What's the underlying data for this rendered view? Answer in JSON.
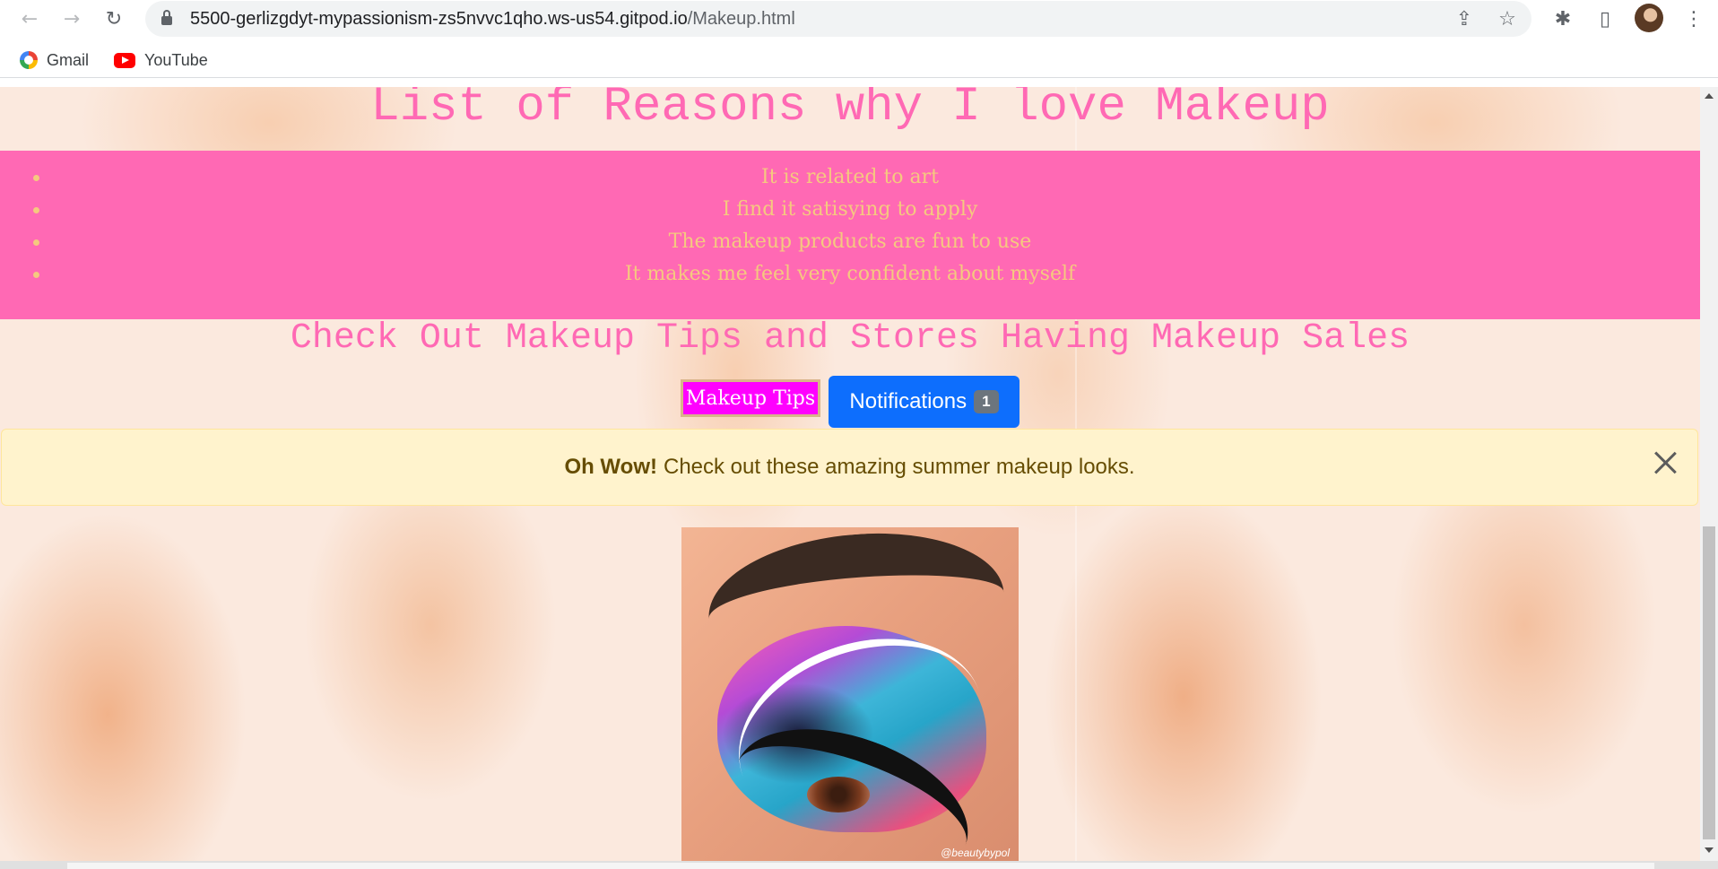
{
  "browser": {
    "url_host": "5500-gerlizgdyt-mypassionism-zs5nvvc1qho.ws-us54.gitpod.io",
    "url_path": "/Makeup.html",
    "nav": {
      "back_icon": "←",
      "forward_icon": "→",
      "reload_icon": "↻"
    },
    "omnibox_icons": {
      "share_icon": "⇪",
      "star_icon": "☆"
    },
    "toolbar_icons": {
      "extensions_icon": "✱",
      "sidepanel_icon": "▯",
      "menu_icon": "⋮"
    },
    "bookmarks": [
      {
        "label": "Gmail",
        "icon": "google-icon"
      },
      {
        "label": "YouTube",
        "icon": "youtube-icon"
      }
    ]
  },
  "page": {
    "title": "List of Reasons why I love Makeup",
    "reasons": [
      "It is related to art",
      "I find it satisying to apply",
      "The makeup products are fun to use",
      "It makes me feel very confident about myself"
    ],
    "subtitle": "Check Out Makeup Tips and Stores Having Makeup Sales",
    "buttons": {
      "tips_label": "Makeup Tips",
      "notifications_label": "Notifications",
      "notifications_count": "1"
    },
    "alert": {
      "strong": "Oh Wow!",
      "text": "Check out these amazing summer makeup looks."
    },
    "image": {
      "credit": "@beautybypol"
    }
  },
  "colors": {
    "accent_pink": "#ff69b4",
    "list_text": "#f5c97f",
    "tips_button": "#ff00ff",
    "notif_button": "#0d6efd",
    "alert_bg": "#fff3cd"
  }
}
